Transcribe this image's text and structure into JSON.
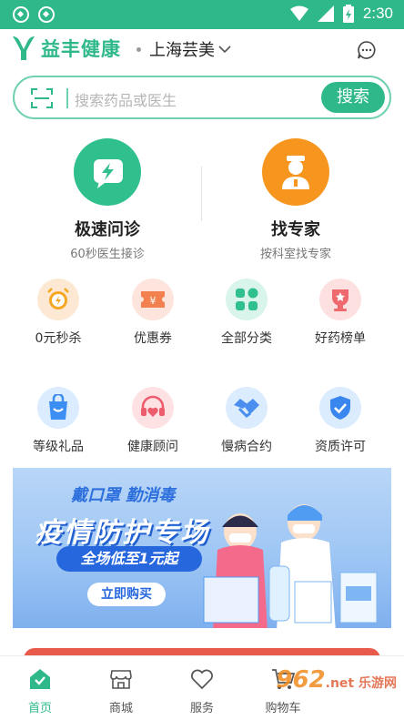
{
  "status_bar": {
    "time": "2:30"
  },
  "header": {
    "app_name": "益丰健康",
    "location": "上海芸美"
  },
  "search": {
    "placeholder": "搜索药品或医生",
    "button": "搜索"
  },
  "features": [
    {
      "title": "极速问诊",
      "subtitle": "60秒医生接诊",
      "icon": "lightning-chat-icon",
      "color": "#2fc08e"
    },
    {
      "title": "找专家",
      "subtitle": "按科室找专家",
      "icon": "doctor-icon",
      "color": "#f7961f"
    }
  ],
  "grid": [
    {
      "label": "0元秒杀",
      "icon": "alarm-clock-icon",
      "color": "#fde9d3",
      "accent": "#f6a623"
    },
    {
      "label": "优惠券",
      "icon": "coupon-icon",
      "color": "#fde4dc",
      "accent": "#f3814f"
    },
    {
      "label": "全部分类",
      "icon": "grid-category-icon",
      "color": "#d9f4ea",
      "accent": "#2fc08e"
    },
    {
      "label": "好药榜单",
      "icon": "trophy-icon",
      "color": "#fde1e0",
      "accent": "#ee6a6f"
    },
    {
      "label": "等级礼品",
      "icon": "gift-bag-icon",
      "color": "#dcecff",
      "accent": "#3d8ef2"
    },
    {
      "label": "健康顾问",
      "icon": "headset-heart-icon",
      "color": "#fde1e3",
      "accent": "#ee5b6c"
    },
    {
      "label": "慢病合约",
      "icon": "handshake-icon",
      "color": "#dcecff",
      "accent": "#4a8ff0"
    },
    {
      "label": "资质许可",
      "icon": "shield-check-icon",
      "color": "#dcecff",
      "accent": "#3a86ef"
    }
  ],
  "banner": {
    "tag": "戴口罩 勤消毒",
    "title": "疫情防护专场",
    "promo": "全场低至1元起",
    "button": "立即购买"
  },
  "bottom_nav": [
    {
      "label": "首页",
      "icon": "home-icon",
      "active": true
    },
    {
      "label": "商城",
      "icon": "store-icon",
      "active": false
    },
    {
      "label": "服务",
      "icon": "heart-icon",
      "active": false
    },
    {
      "label": "购物车",
      "icon": "cart-icon",
      "active": false
    }
  ],
  "watermark": {
    "text": "962",
    "sub": ".net 乐游网"
  },
  "colors": {
    "brand": "#2fb98a",
    "accent_orange": "#f7961f"
  }
}
